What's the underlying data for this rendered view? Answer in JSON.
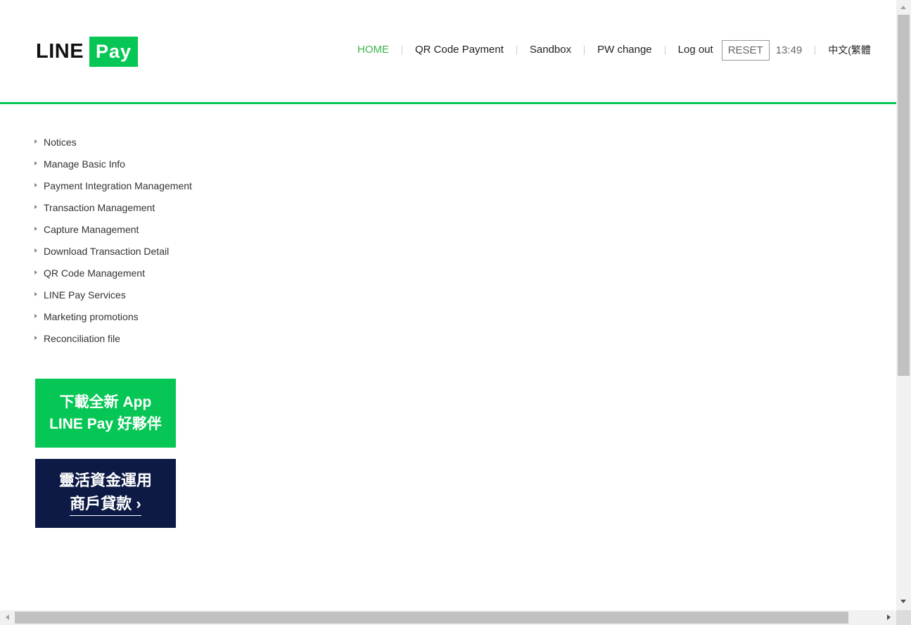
{
  "brand": {
    "logo_word": "LINE",
    "logo_badge": "Pay",
    "accent_color": "#06c755",
    "navy_color": "#0c1a45"
  },
  "nav": {
    "home": "HOME",
    "qr_code_payment": "QR Code Payment",
    "sandbox": "Sandbox",
    "pw_change": "PW change",
    "log_out": "Log out",
    "reset": "RESET",
    "clock": "13:49",
    "language": "中文(繁體"
  },
  "menu": {
    "items": [
      {
        "label": "Notices"
      },
      {
        "label": "Manage Basic Info"
      },
      {
        "label": "Payment Integration Management"
      },
      {
        "label": "Transaction Management"
      },
      {
        "label": "Capture Management"
      },
      {
        "label": "Download Transaction Detail"
      },
      {
        "label": "QR Code Management"
      },
      {
        "label": "LINE Pay Services"
      },
      {
        "label": "Marketing promotions"
      },
      {
        "label": "Reconciliation file"
      }
    ]
  },
  "banners": {
    "app": {
      "line1": "下載全新 App",
      "line2": "LINE Pay 好夥伴"
    },
    "loan": {
      "line1": "靈活資金運用",
      "line2": "商戶貸款 ›"
    }
  }
}
